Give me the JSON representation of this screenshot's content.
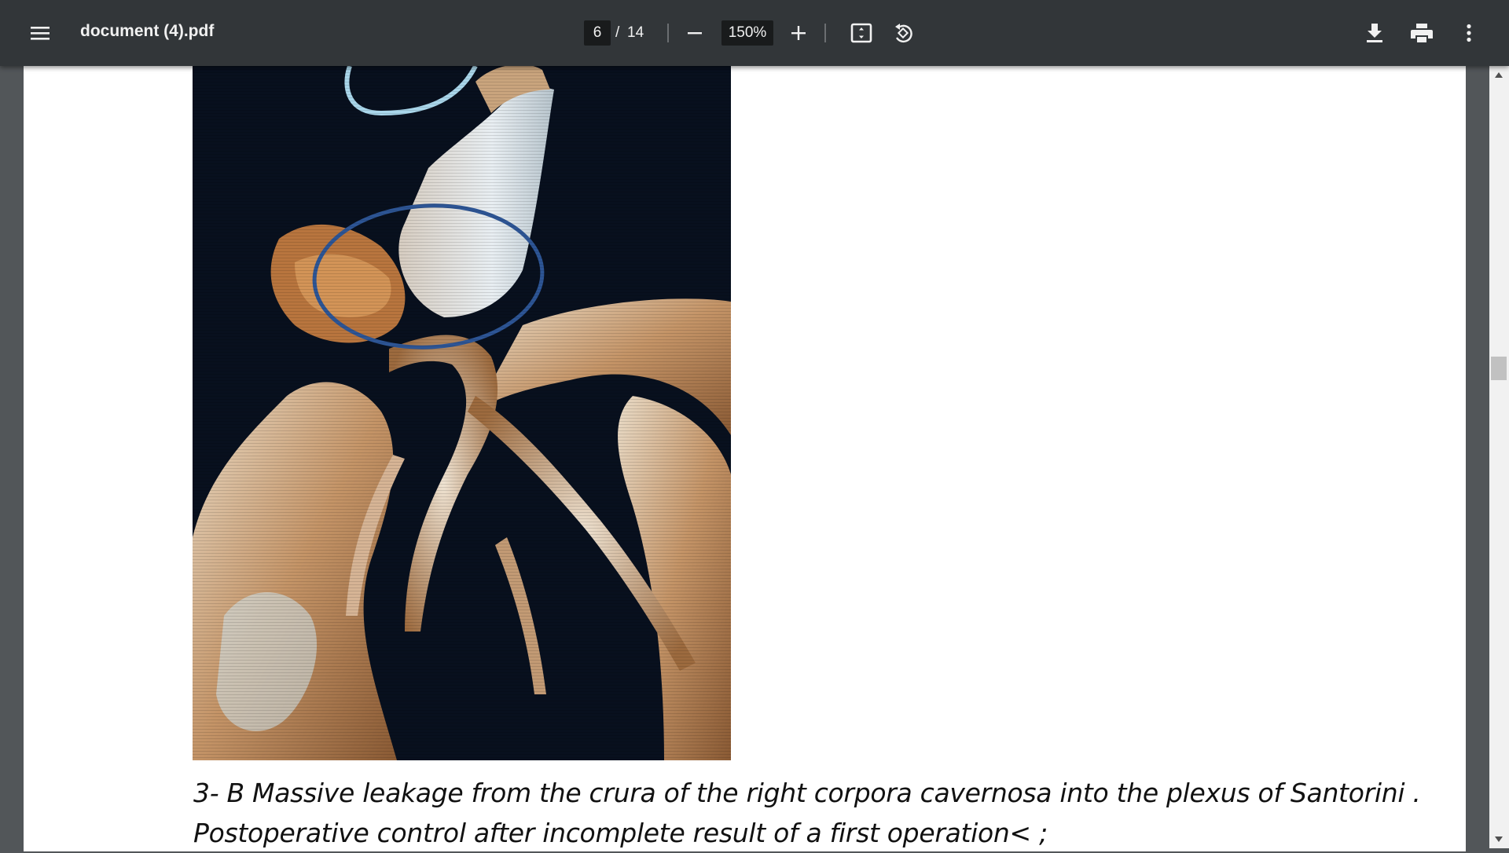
{
  "toolbar": {
    "menu_icon": "hamburger-menu-icon",
    "title": "document (4).pdf",
    "page_current": "6",
    "page_separator": "/",
    "page_total": "14",
    "zoom_out_icon": "minus-icon",
    "zoom_level": "150%",
    "zoom_in_icon": "plus-icon",
    "fit_icon": "fit-to-page-icon",
    "rotate_icon": "rotate-counterclockwise-icon",
    "download_icon": "download-icon",
    "print_icon": "print-icon",
    "more_icon": "more-vertical-icon"
  },
  "document": {
    "figure_description_icon": "ct-angiography-image",
    "caption_line_1": "3- B Massive leakage from the crura of the right corpora cavernosa into the plexus of Santorini .",
    "caption_line_2": "Postoperative control after incomplete result of a first operation< ;"
  },
  "colors": {
    "toolbar_bg": "#323639",
    "viewer_bg": "#525659",
    "page_bg": "#ffffff",
    "annotation_ellipse": "#2d5595"
  }
}
